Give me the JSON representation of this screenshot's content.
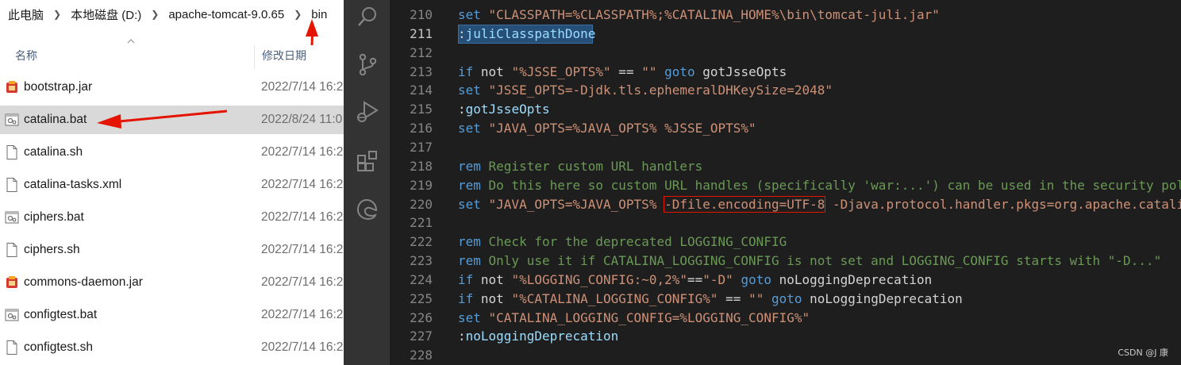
{
  "explorer": {
    "breadcrumb": [
      "此电脑",
      "本地磁盘 (D:)",
      "apache-tomcat-9.0.65",
      "bin"
    ],
    "columns": {
      "name": "名称",
      "date": "修改日期"
    },
    "files": [
      {
        "name": "bootstrap.jar",
        "date": "2022/7/14 16:2",
        "icon": "jar-icon"
      },
      {
        "name": "catalina.bat",
        "date": "2022/8/24 11:0",
        "icon": "bat-file-icon",
        "selected": true
      },
      {
        "name": "catalina.sh",
        "date": "2022/7/14 16:2",
        "icon": "file-icon"
      },
      {
        "name": "catalina-tasks.xml",
        "date": "2022/7/14 16:2",
        "icon": "file-icon"
      },
      {
        "name": "ciphers.bat",
        "date": "2022/7/14 16:2",
        "icon": "bat-file-icon"
      },
      {
        "name": "ciphers.sh",
        "date": "2022/7/14 16:2",
        "icon": "file-icon"
      },
      {
        "name": "commons-daemon.jar",
        "date": "2022/7/14 16:2",
        "icon": "jar-icon"
      },
      {
        "name": "configtest.bat",
        "date": "2022/7/14 16:2",
        "icon": "bat-file-icon"
      },
      {
        "name": "configtest.sh",
        "date": "2022/7/14 16:2",
        "icon": "file-icon"
      }
    ]
  },
  "editor": {
    "activity_icons": [
      "search-icon",
      "source-control-icon",
      "run-debug-icon",
      "extensions-icon",
      "edge-icon"
    ],
    "lines": [
      {
        "num": "210",
        "tokens": [
          [
            "kw",
            "set "
          ],
          [
            "str",
            "\"CLASSPATH=%CLASSPATH%;%CATALINA_HOME%\\bin\\tomcat-juli.jar\""
          ]
        ]
      },
      {
        "num": "211",
        "active": true,
        "tokens": [
          [
            "pl",
            ":"
          ],
          [
            "lbl",
            "juliClasspathDone"
          ]
        ]
      },
      {
        "num": "212",
        "tokens": []
      },
      {
        "num": "213",
        "tokens": [
          [
            "kw",
            "if "
          ],
          [
            "pl",
            "not "
          ],
          [
            "str",
            "\"%JSSE_OPTS%\""
          ],
          [
            "pl",
            " == "
          ],
          [
            "str",
            "\"\""
          ],
          [
            "pl",
            " "
          ],
          [
            "kw",
            "goto "
          ],
          [
            "pl",
            "gotJsseOpts"
          ]
        ]
      },
      {
        "num": "214",
        "tokens": [
          [
            "kw",
            "set "
          ],
          [
            "str",
            "\"JSSE_OPTS=-Djdk.tls.ephemeralDHKeySize=2048\""
          ]
        ]
      },
      {
        "num": "215",
        "tokens": [
          [
            "pl",
            ":"
          ],
          [
            "lbl",
            "gotJsseOpts"
          ]
        ]
      },
      {
        "num": "216",
        "tokens": [
          [
            "kw",
            "set "
          ],
          [
            "str",
            "\"JAVA_OPTS=%JAVA_OPTS% %JSSE_OPTS%\""
          ]
        ]
      },
      {
        "num": "217",
        "tokens": []
      },
      {
        "num": "218",
        "tokens": [
          [
            "kw",
            "rem "
          ],
          [
            "cm",
            "Register custom URL handlers"
          ]
        ]
      },
      {
        "num": "219",
        "tokens": [
          [
            "kw",
            "rem "
          ],
          [
            "cm",
            "Do this here so custom URL handles (specifically 'war:...') can be used in the security pol"
          ]
        ]
      },
      {
        "num": "220",
        "tokens": [
          [
            "kw",
            "set "
          ],
          [
            "str",
            "\"JAVA_OPTS=%JAVA_OPTS% "
          ],
          [
            "hl",
            "-Dfile.encoding=UTF-8"
          ],
          [
            "str",
            " -Djava.protocol.handler.pkgs=org.apache.catali"
          ]
        ]
      },
      {
        "num": "221",
        "tokens": []
      },
      {
        "num": "222",
        "tokens": [
          [
            "kw",
            "rem "
          ],
          [
            "cm",
            "Check for the deprecated LOGGING_CONFIG"
          ]
        ]
      },
      {
        "num": "223",
        "tokens": [
          [
            "kw",
            "rem "
          ],
          [
            "cm",
            "Only use it if CATALINA_LOGGING_CONFIG is not set and LOGGING_CONFIG starts with \"-D...\""
          ]
        ]
      },
      {
        "num": "224",
        "tokens": [
          [
            "kw",
            "if "
          ],
          [
            "pl",
            "not "
          ],
          [
            "str",
            "\"%LOGGING_CONFIG:~0,2%\""
          ],
          [
            "pl",
            "=="
          ],
          [
            "str",
            "\"-D\""
          ],
          [
            "pl",
            " "
          ],
          [
            "kw",
            "goto "
          ],
          [
            "pl",
            "noLoggingDeprecation"
          ]
        ]
      },
      {
        "num": "225",
        "tokens": [
          [
            "kw",
            "if "
          ],
          [
            "pl",
            "not "
          ],
          [
            "str",
            "\"%CATALINA_LOGGING_CONFIG%\""
          ],
          [
            "pl",
            " == "
          ],
          [
            "str",
            "\"\""
          ],
          [
            "pl",
            " "
          ],
          [
            "kw",
            "goto "
          ],
          [
            "pl",
            "noLoggingDeprecation"
          ]
        ]
      },
      {
        "num": "226",
        "tokens": [
          [
            "kw",
            "set "
          ],
          [
            "str",
            "\"CATALINA_LOGGING_CONFIG=%LOGGING_CONFIG%\""
          ]
        ]
      },
      {
        "num": "227",
        "tokens": [
          [
            "pl",
            ":"
          ],
          [
            "lbl",
            "noLoggingDeprecation"
          ]
        ]
      },
      {
        "num": "228",
        "tokens": []
      }
    ]
  },
  "watermark": "CSDN @J 康",
  "colors": {
    "annotation_red": "#e51400",
    "editor_bg": "#1e1e1e",
    "activity_bar": "#333333"
  }
}
